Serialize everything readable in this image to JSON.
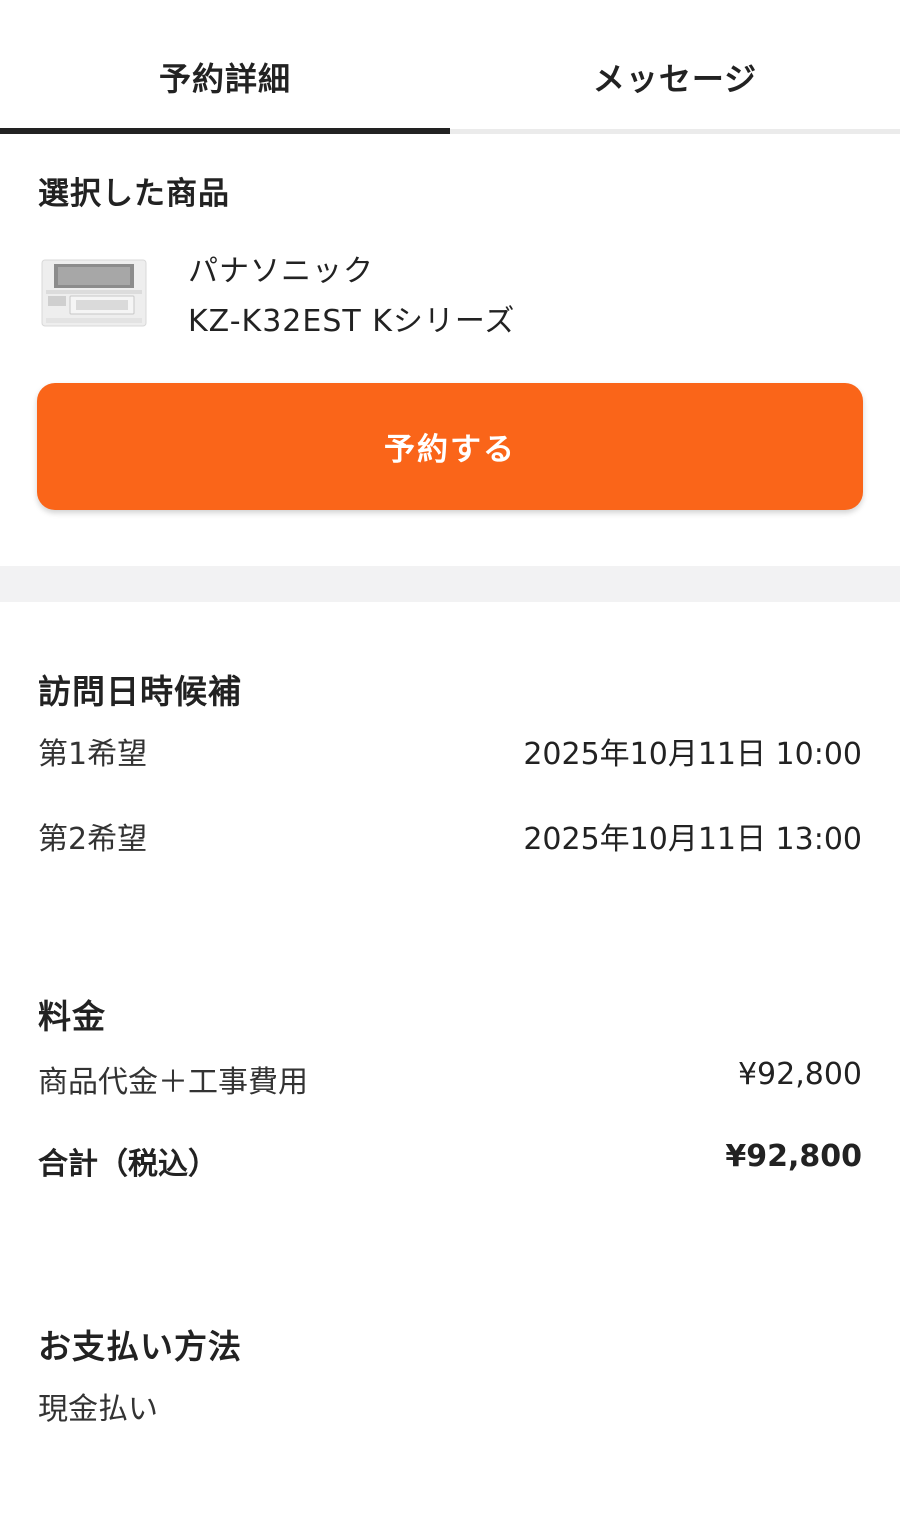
{
  "tabs": [
    {
      "label": "予約詳細",
      "active": true
    },
    {
      "label": "メッセージ",
      "active": false
    }
  ],
  "product": {
    "section_title": "選択した商品",
    "maker": "パナソニック",
    "model": "KZ-K32EST Kシリーズ",
    "image_icon": "ih-cooktop-image"
  },
  "reserve_button": {
    "label": "予約する",
    "color": "#fa6519"
  },
  "visit": {
    "section_title": "訪問日時候補",
    "rows": [
      {
        "label": "第1希望",
        "value": "2025年10月11日 10:00"
      },
      {
        "label": "第2希望",
        "value": "2025年10月11日 13:00"
      }
    ]
  },
  "price": {
    "section_title": "料金",
    "rows": [
      {
        "label": "商品代金＋工事費用",
        "value": "¥92,800"
      },
      {
        "label": "合計（税込）",
        "value": "¥92,800"
      }
    ]
  },
  "payment": {
    "section_title": "お支払い方法",
    "method": "現金払い"
  }
}
